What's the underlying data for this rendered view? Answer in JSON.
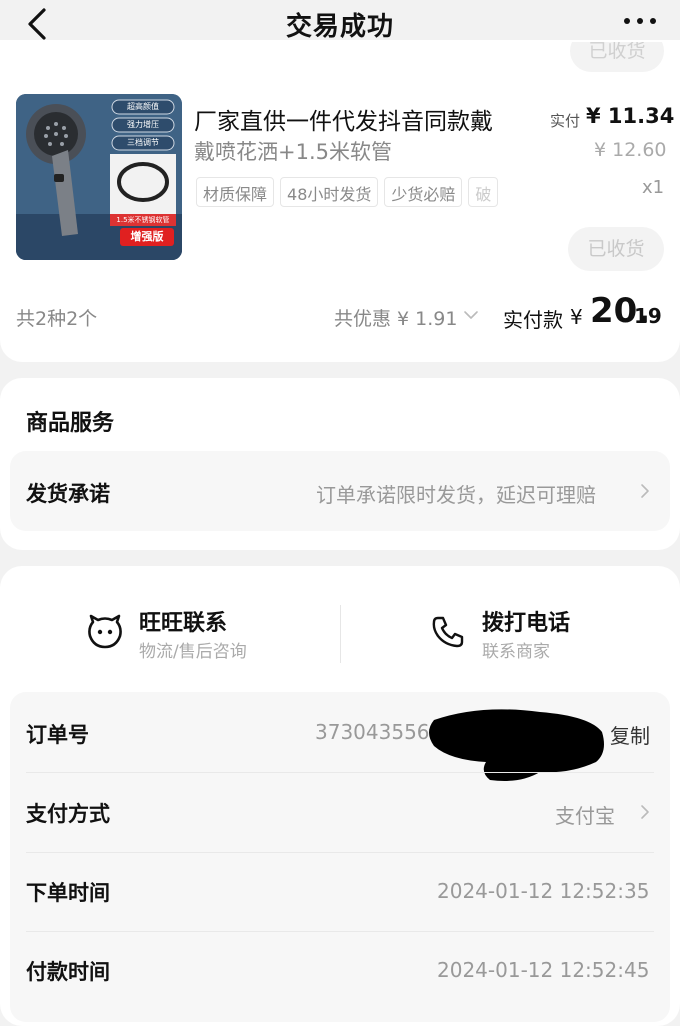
{
  "header": {
    "title": "交易成功"
  },
  "product": {
    "title_line1": "厂家直供一件代发抖音同款戴",
    "title_line2": "戴喷花洒+1.5米软管",
    "tags": [
      "材质保障",
      "48小时发货",
      "少货必赔",
      "破"
    ],
    "paid_label": "实付",
    "paid_price": "¥ 11.34",
    "original_price": "¥ 12.60",
    "quantity": "x1",
    "status_button": "已收货",
    "top_status_button": "已收货",
    "image_badges": [
      "超高颜值",
      "强力增压",
      "三档调节"
    ],
    "image_hose_label": "1.5米不锈钢软管",
    "image_edition": "增强版"
  },
  "summary": {
    "count": "共2种2个",
    "discount": "共优惠 ¥ 1.91",
    "pay_label": "实付款",
    "pay_yen": "¥",
    "pay_int": "20.",
    "pay_dec": "19"
  },
  "service": {
    "title": "商品服务",
    "row_label": "发货承诺",
    "row_value": "订单承诺限时发货，延迟可理赔"
  },
  "contact": {
    "wangwang_title": "旺旺联系",
    "wangwang_sub": "物流/售后咨询",
    "phone_title": "拨打电话",
    "phone_sub": "联系商家"
  },
  "order_info": {
    "order_no_label": "订单号",
    "order_no_value": "373043556",
    "copy_label": "复制",
    "pay_method_label": "支付方式",
    "pay_method_value": "支付宝",
    "order_time_label": "下单时间",
    "order_time_value": "2024-01-12 12:52:35",
    "pay_time_label": "付款时间",
    "pay_time_value": "2024-01-12 12:52:45"
  },
  "icons": {
    "back": "chevron-left-icon",
    "more": "more-dots-icon",
    "wangwang": "wangwang-face-icon",
    "phone": "phone-icon",
    "chevron": "chevron-right-icon"
  }
}
